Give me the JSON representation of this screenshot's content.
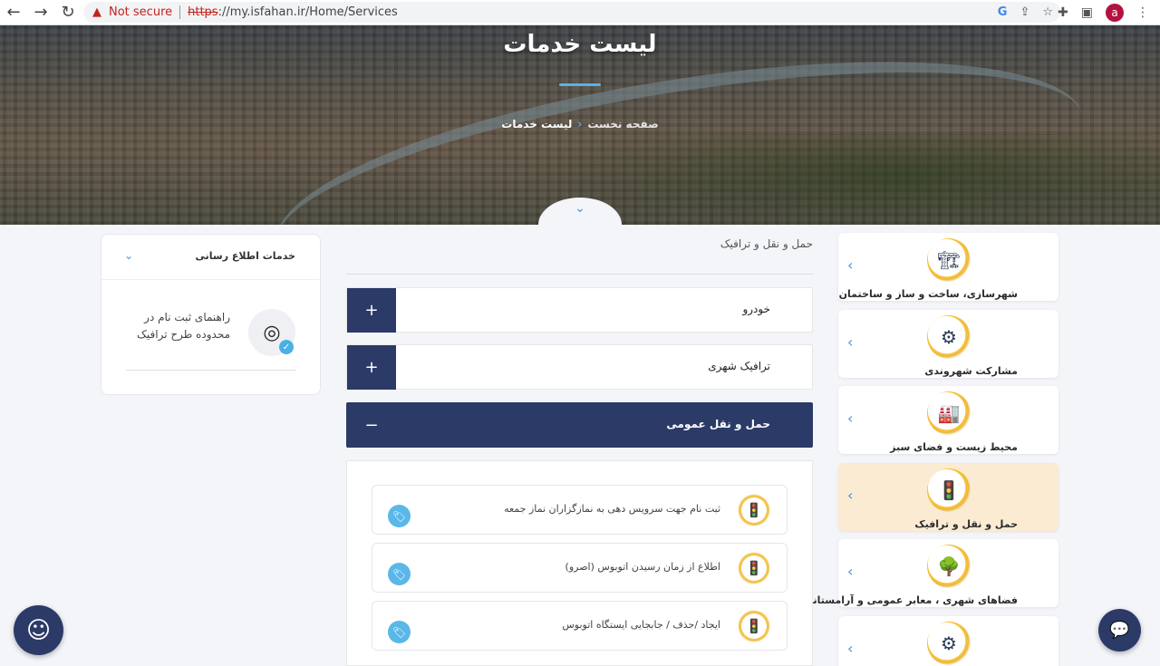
{
  "browser": {
    "back_icon": "←",
    "forward_icon": "→",
    "reload_icon": "↻",
    "warning_icon": "▲",
    "not_secure": "Not secure",
    "url_scheme": "https",
    "url_rest": "://my.isfahan.ir/Home/Services",
    "google_icon": "G",
    "share_icon": "⇪",
    "star_icon": "☆",
    "extensions_icon": "✚",
    "sidepanel_icon": "▣",
    "avatar_letter": "a",
    "menu_icon": "⋮"
  },
  "hero": {
    "title": "لیست خدمات",
    "breadcrumb_home": "صفحه نخست",
    "breadcrumb_separator": "›",
    "breadcrumb_current": "لیست خدمات",
    "scroll_down_icon": "⌄"
  },
  "categories": [
    {
      "label": "شهرسازی، ساخت و ساز و ساختمان",
      "icon": "🏗",
      "chevron": "‹"
    },
    {
      "label": "مشارکت شهروندی",
      "icon": "⚙",
      "chevron": "‹"
    },
    {
      "label": "محیط زیست و فضای سبز",
      "icon": "🏭",
      "chevron": "‹"
    },
    {
      "label": "حمل و نقل و ترافیک",
      "icon": "🚦",
      "chevron": "‹"
    },
    {
      "label": "فضاهای شهری ، معابر عمومی و آرامستانها",
      "icon": "🌳",
      "chevron": "‹"
    },
    {
      "label": "",
      "icon": "⚙",
      "chevron": "‹"
    }
  ],
  "main": {
    "section_title": "حمل و نقل و ترافیک",
    "accordions": [
      {
        "title": "خودرو",
        "toggle": "+"
      },
      {
        "title": "ترافیک شهری",
        "toggle": "+"
      },
      {
        "title": "حمل و نقل عمومی",
        "toggle": "−"
      }
    ],
    "services": [
      {
        "text": "ثبت نام جهت سرویس دهی به نمازگزاران نماز جمعه",
        "icon": "🚦",
        "tag_icon": "🏷"
      },
      {
        "text": "اطلاع از زمان رسیدن اتوبوس (اصرو)",
        "icon": "🚦",
        "tag_icon": "🏷"
      },
      {
        "text": "ایجاد /حذف / جابجایی ایستگاه اتوبوس",
        "icon": "🚦",
        "tag_icon": "🏷"
      }
    ]
  },
  "sidebar": {
    "title": "خدمات اطلاع رسانی",
    "chevron": "⌄",
    "item_text": "راهنمای ثبت نام در محدوده طرح ترافیک",
    "item_icon": "◎",
    "item_check": "✓"
  },
  "fab": {
    "left_icon": "☺",
    "right_icon": "💬"
  }
}
